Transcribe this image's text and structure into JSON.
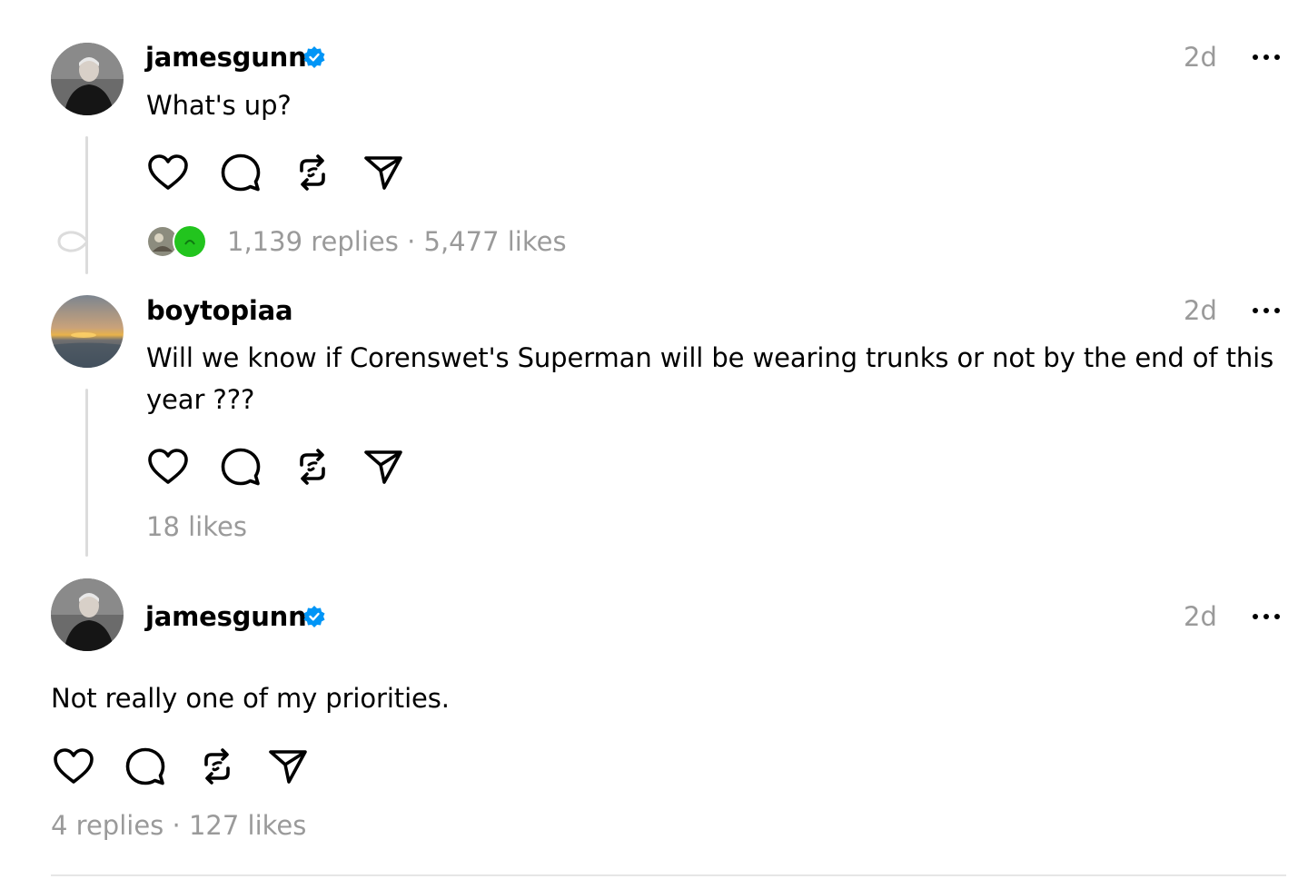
{
  "posts": [
    {
      "username": "jamesgunn",
      "verified": true,
      "time": "2d",
      "text": "What's up?",
      "replies_label": "1,139 replies",
      "separator": "·",
      "likes_label": "5,477 likes"
    },
    {
      "username": "boytopiaa",
      "verified": false,
      "time": "2d",
      "text_line1": "Will we know if Corenswet's Superman will be wearing trunks or not by the end of this",
      "text_line2": "year ???",
      "likes_label": "18 likes"
    },
    {
      "username": "jamesgunn",
      "verified": true,
      "time": "2d",
      "text": "Not really one of my priorities.",
      "replies_label": "4 replies",
      "separator": "·",
      "likes_label": "127 likes"
    }
  ],
  "colors": {
    "verified_blue": "#0095f6",
    "muted_text": "#9a9a9a",
    "thread_line": "#dcdcdc"
  },
  "icons": {
    "like": "heart-icon",
    "reply": "comment-bubble-icon",
    "repost": "repost-icon",
    "share": "send-icon",
    "more": "more-dots-icon",
    "verified": "verified-badge-icon"
  }
}
